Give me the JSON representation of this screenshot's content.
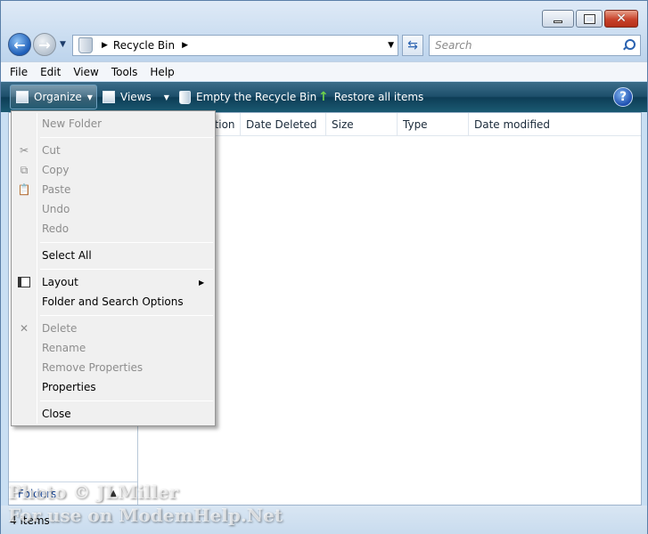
{
  "window": {
    "caption": {
      "minimize": "minimize",
      "maximize": "maximize",
      "close": "close"
    }
  },
  "address": {
    "location": "Recycle Bin"
  },
  "search": {
    "placeholder": "Search"
  },
  "menubar": {
    "items": [
      "File",
      "Edit",
      "View",
      "Tools",
      "Help"
    ]
  },
  "commandbar": {
    "organize": "Organize",
    "views": "Views",
    "empty": "Empty the Recycle Bin",
    "restore": "Restore all items"
  },
  "columns": [
    "Original Location",
    "Date Deleted",
    "Size",
    "Type",
    "Date modified"
  ],
  "navpane": {
    "folders": "Folders"
  },
  "status": {
    "count": "4 items"
  },
  "organize_menu": {
    "new_folder": "New Folder",
    "cut": "Cut",
    "copy": "Copy",
    "paste": "Paste",
    "undo": "Undo",
    "redo": "Redo",
    "select_all": "Select All",
    "layout": "Layout",
    "folder_options": "Folder and Search Options",
    "delete": "Delete",
    "rename": "Rename",
    "remove_properties": "Remove Properties",
    "properties": "Properties",
    "close": "Close"
  },
  "watermark": {
    "line1": "Photo © JLMiller",
    "line2": "For use on ModemHelp.Net"
  },
  "icons": [
    "back-arrow-icon",
    "forward-arrow-icon",
    "recycle-bin-icon",
    "refresh-icon",
    "search-icon",
    "organize-icon",
    "views-icon",
    "empty-bin-icon",
    "restore-icon",
    "help-icon",
    "cut-icon",
    "copy-icon",
    "paste-icon",
    "layout-icon",
    "delete-icon"
  ]
}
